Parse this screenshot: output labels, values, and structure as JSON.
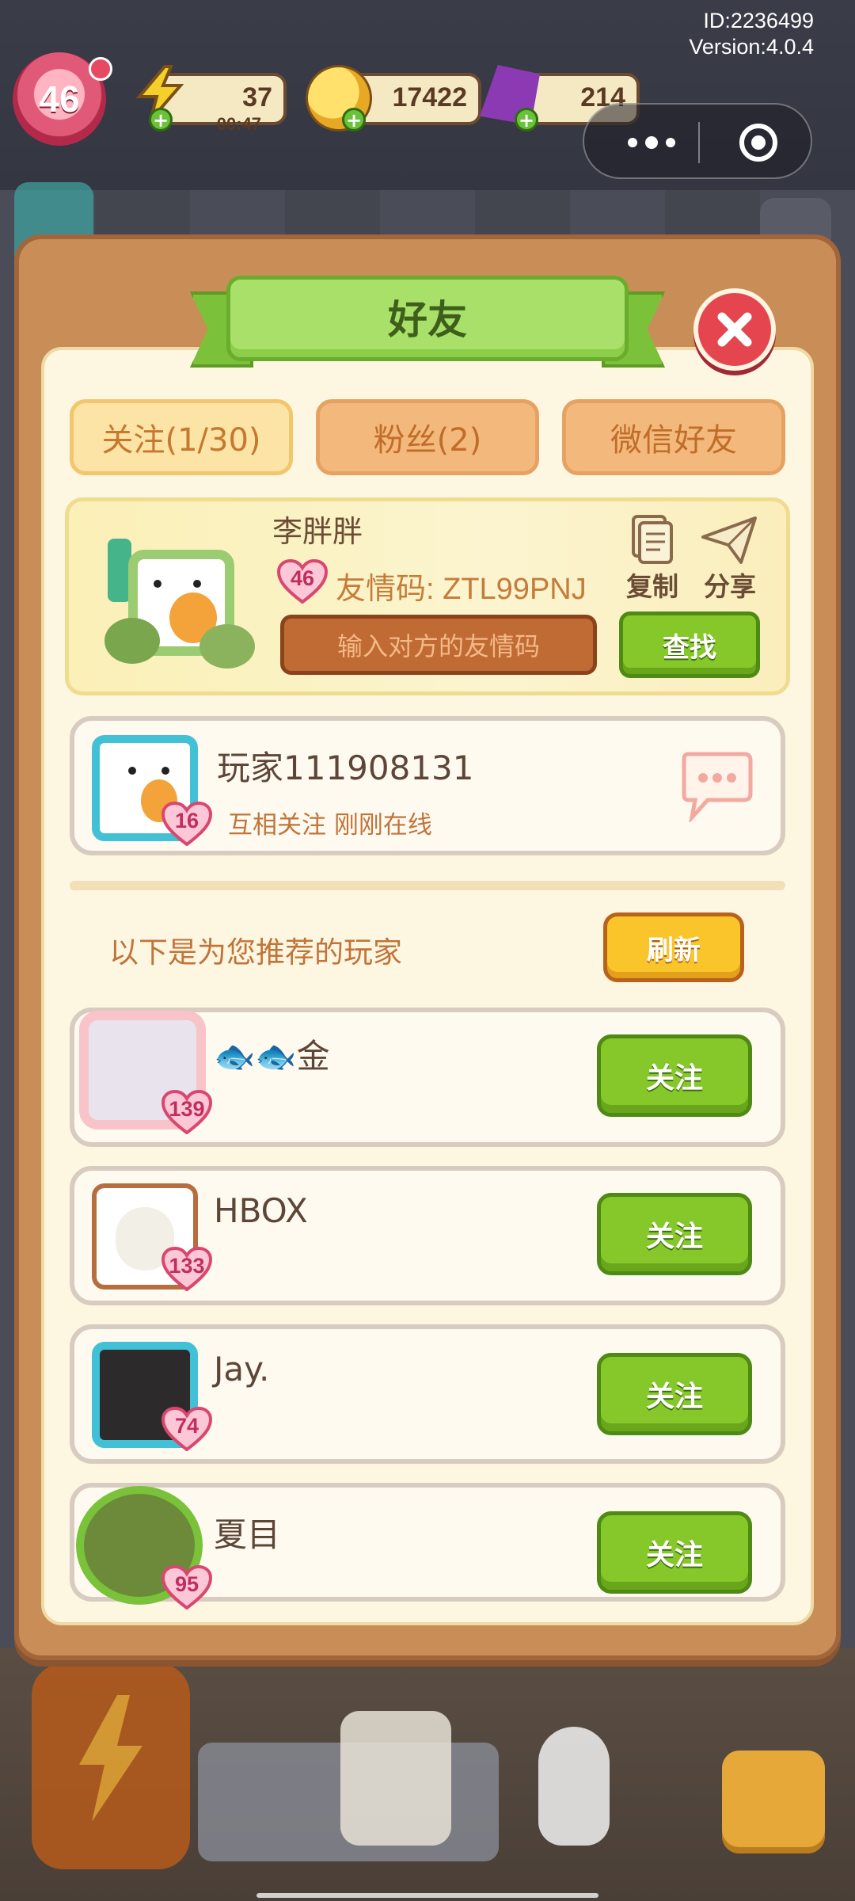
{
  "hud": {
    "id_text": "ID:2236499",
    "version_text": "Version:4.0.4",
    "level": "46",
    "energy": "37",
    "energy_timer": "00:47",
    "coins": "17422",
    "gems": "214"
  },
  "dialog": {
    "title": "好友",
    "tabs": [
      {
        "label": "关注(1/30)",
        "active": true
      },
      {
        "label": "粉丝(2)",
        "active": false
      },
      {
        "label": "微信好友",
        "active": false
      }
    ],
    "profile": {
      "name": "李胖胖",
      "level": "46",
      "friend_code": "友情码: ZTL99PNJ",
      "copy_label": "复制",
      "share_label": "分享",
      "code_input_placeholder": "输入对方的友情码",
      "find_label": "查找"
    },
    "friends": [
      {
        "name": "玩家111908131",
        "level": "16",
        "status": "互相关注  刚刚在线"
      }
    ],
    "recommend_text": "以下是为您推荐的玩家",
    "refresh_label": "刷新",
    "recommended": [
      {
        "name": "🐟🐟金",
        "level": "139",
        "follow_label": "关注"
      },
      {
        "name": "HBOX",
        "level": "133",
        "follow_label": "关注"
      },
      {
        "name": "Jay.",
        "level": "74",
        "follow_label": "关注"
      },
      {
        "name": "夏目",
        "level": "95",
        "follow_label": "关注"
      }
    ]
  },
  "colors": {
    "dialog_border": "#c98d57",
    "panel_bg": "#fdf7e2",
    "green_button": "#86c82a",
    "yellow_button": "#f9c52a",
    "heart_pink": "#f5a0bb"
  }
}
